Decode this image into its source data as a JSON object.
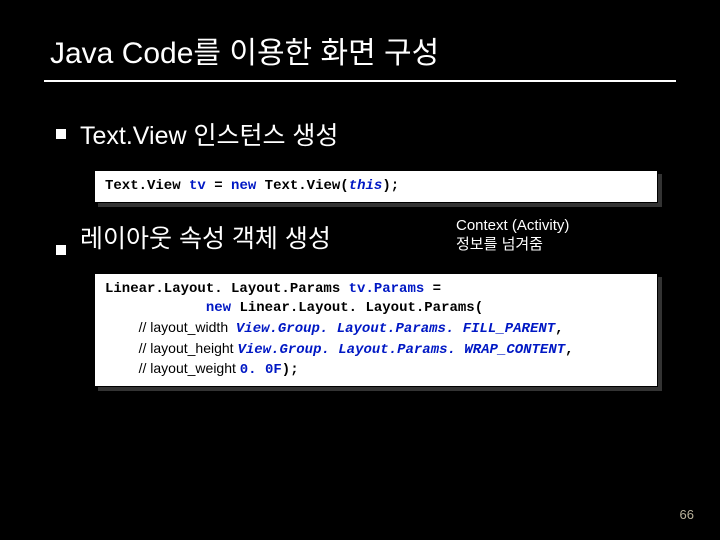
{
  "title": "Java  Code를 이용한 화면 구성",
  "bullets": {
    "b1": "Text.View 인스턴스 생성",
    "b2": "레이아웃 속성 객체 생성"
  },
  "annotation": {
    "line1": "Context (Activity)",
    "line2": "정보를 넘겨줌"
  },
  "code1": {
    "t_type1": "Text.View ",
    "t_var1": "tv",
    "t_eq": " = ",
    "t_new": "new",
    "t_sp": " ",
    "t_type2": "Text.View",
    "t_lp": "(",
    "t_this": "this",
    "t_rp": ")",
    "t_semi": ";"
  },
  "code2": {
    "l1": {
      "t1": "Linear.Layout. Layout.Params ",
      "var": "tv.Params",
      "eq": " ="
    },
    "l2": {
      "indent": "            ",
      "new": "new",
      "sp": " ",
      "t1": "Linear.Layout. Layout.Params",
      "lp": "("
    },
    "l3": {
      "indent": "    ",
      "comment": "// layout_width  ",
      "val": "View.Group. Layout.Params. FILL_PARENT",
      "comma": ","
    },
    "l4": {
      "indent": "    ",
      "comment": "// layout_height ",
      "val": "View.Group. Layout.Params. WRAP_CONTENT",
      "comma": ","
    },
    "l5": {
      "indent": "    ",
      "comment": "// layout_weight ",
      "val": "0. 0F",
      "rp": ")",
      "semi": ";"
    }
  },
  "page": "66"
}
